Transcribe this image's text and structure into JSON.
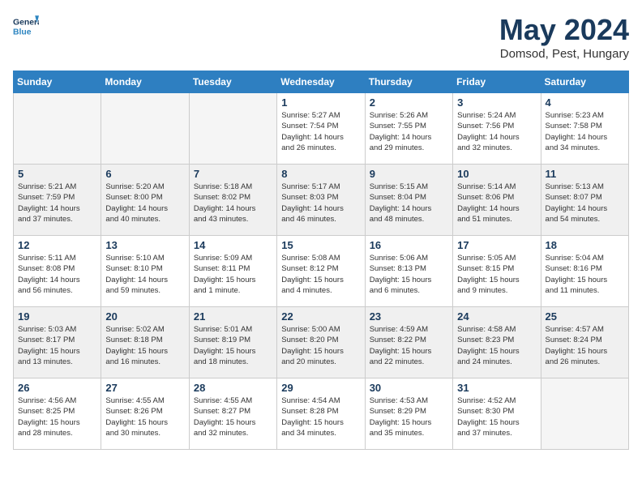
{
  "header": {
    "logo_line1": "General",
    "logo_line2": "Blue",
    "month": "May 2024",
    "location": "Domsod, Pest, Hungary"
  },
  "weekdays": [
    "Sunday",
    "Monday",
    "Tuesday",
    "Wednesday",
    "Thursday",
    "Friday",
    "Saturday"
  ],
  "weeks": [
    [
      {
        "day": "",
        "info": "",
        "empty": true
      },
      {
        "day": "",
        "info": "",
        "empty": true
      },
      {
        "day": "",
        "info": "",
        "empty": true
      },
      {
        "day": "1",
        "info": "Sunrise: 5:27 AM\nSunset: 7:54 PM\nDaylight: 14 hours\nand 26 minutes.",
        "empty": false
      },
      {
        "day": "2",
        "info": "Sunrise: 5:26 AM\nSunset: 7:55 PM\nDaylight: 14 hours\nand 29 minutes.",
        "empty": false
      },
      {
        "day": "3",
        "info": "Sunrise: 5:24 AM\nSunset: 7:56 PM\nDaylight: 14 hours\nand 32 minutes.",
        "empty": false
      },
      {
        "day": "4",
        "info": "Sunrise: 5:23 AM\nSunset: 7:58 PM\nDaylight: 14 hours\nand 34 minutes.",
        "empty": false
      }
    ],
    [
      {
        "day": "5",
        "info": "Sunrise: 5:21 AM\nSunset: 7:59 PM\nDaylight: 14 hours\nand 37 minutes.",
        "empty": false,
        "shaded": true
      },
      {
        "day": "6",
        "info": "Sunrise: 5:20 AM\nSunset: 8:00 PM\nDaylight: 14 hours\nand 40 minutes.",
        "empty": false,
        "shaded": true
      },
      {
        "day": "7",
        "info": "Sunrise: 5:18 AM\nSunset: 8:02 PM\nDaylight: 14 hours\nand 43 minutes.",
        "empty": false,
        "shaded": true
      },
      {
        "day": "8",
        "info": "Sunrise: 5:17 AM\nSunset: 8:03 PM\nDaylight: 14 hours\nand 46 minutes.",
        "empty": false,
        "shaded": true
      },
      {
        "day": "9",
        "info": "Sunrise: 5:15 AM\nSunset: 8:04 PM\nDaylight: 14 hours\nand 48 minutes.",
        "empty": false,
        "shaded": true
      },
      {
        "day": "10",
        "info": "Sunrise: 5:14 AM\nSunset: 8:06 PM\nDaylight: 14 hours\nand 51 minutes.",
        "empty": false,
        "shaded": true
      },
      {
        "day": "11",
        "info": "Sunrise: 5:13 AM\nSunset: 8:07 PM\nDaylight: 14 hours\nand 54 minutes.",
        "empty": false,
        "shaded": true
      }
    ],
    [
      {
        "day": "12",
        "info": "Sunrise: 5:11 AM\nSunset: 8:08 PM\nDaylight: 14 hours\nand 56 minutes.",
        "empty": false
      },
      {
        "day": "13",
        "info": "Sunrise: 5:10 AM\nSunset: 8:10 PM\nDaylight: 14 hours\nand 59 minutes.",
        "empty": false
      },
      {
        "day": "14",
        "info": "Sunrise: 5:09 AM\nSunset: 8:11 PM\nDaylight: 15 hours\nand 1 minute.",
        "empty": false
      },
      {
        "day": "15",
        "info": "Sunrise: 5:08 AM\nSunset: 8:12 PM\nDaylight: 15 hours\nand 4 minutes.",
        "empty": false
      },
      {
        "day": "16",
        "info": "Sunrise: 5:06 AM\nSunset: 8:13 PM\nDaylight: 15 hours\nand 6 minutes.",
        "empty": false
      },
      {
        "day": "17",
        "info": "Sunrise: 5:05 AM\nSunset: 8:15 PM\nDaylight: 15 hours\nand 9 minutes.",
        "empty": false
      },
      {
        "day": "18",
        "info": "Sunrise: 5:04 AM\nSunset: 8:16 PM\nDaylight: 15 hours\nand 11 minutes.",
        "empty": false
      }
    ],
    [
      {
        "day": "19",
        "info": "Sunrise: 5:03 AM\nSunset: 8:17 PM\nDaylight: 15 hours\nand 13 minutes.",
        "empty": false,
        "shaded": true
      },
      {
        "day": "20",
        "info": "Sunrise: 5:02 AM\nSunset: 8:18 PM\nDaylight: 15 hours\nand 16 minutes.",
        "empty": false,
        "shaded": true
      },
      {
        "day": "21",
        "info": "Sunrise: 5:01 AM\nSunset: 8:19 PM\nDaylight: 15 hours\nand 18 minutes.",
        "empty": false,
        "shaded": true
      },
      {
        "day": "22",
        "info": "Sunrise: 5:00 AM\nSunset: 8:20 PM\nDaylight: 15 hours\nand 20 minutes.",
        "empty": false,
        "shaded": true
      },
      {
        "day": "23",
        "info": "Sunrise: 4:59 AM\nSunset: 8:22 PM\nDaylight: 15 hours\nand 22 minutes.",
        "empty": false,
        "shaded": true
      },
      {
        "day": "24",
        "info": "Sunrise: 4:58 AM\nSunset: 8:23 PM\nDaylight: 15 hours\nand 24 minutes.",
        "empty": false,
        "shaded": true
      },
      {
        "day": "25",
        "info": "Sunrise: 4:57 AM\nSunset: 8:24 PM\nDaylight: 15 hours\nand 26 minutes.",
        "empty": false,
        "shaded": true
      }
    ],
    [
      {
        "day": "26",
        "info": "Sunrise: 4:56 AM\nSunset: 8:25 PM\nDaylight: 15 hours\nand 28 minutes.",
        "empty": false
      },
      {
        "day": "27",
        "info": "Sunrise: 4:55 AM\nSunset: 8:26 PM\nDaylight: 15 hours\nand 30 minutes.",
        "empty": false
      },
      {
        "day": "28",
        "info": "Sunrise: 4:55 AM\nSunset: 8:27 PM\nDaylight: 15 hours\nand 32 minutes.",
        "empty": false
      },
      {
        "day": "29",
        "info": "Sunrise: 4:54 AM\nSunset: 8:28 PM\nDaylight: 15 hours\nand 34 minutes.",
        "empty": false
      },
      {
        "day": "30",
        "info": "Sunrise: 4:53 AM\nSunset: 8:29 PM\nDaylight: 15 hours\nand 35 minutes.",
        "empty": false
      },
      {
        "day": "31",
        "info": "Sunrise: 4:52 AM\nSunset: 8:30 PM\nDaylight: 15 hours\nand 37 minutes.",
        "empty": false
      },
      {
        "day": "",
        "info": "",
        "empty": true
      }
    ]
  ]
}
